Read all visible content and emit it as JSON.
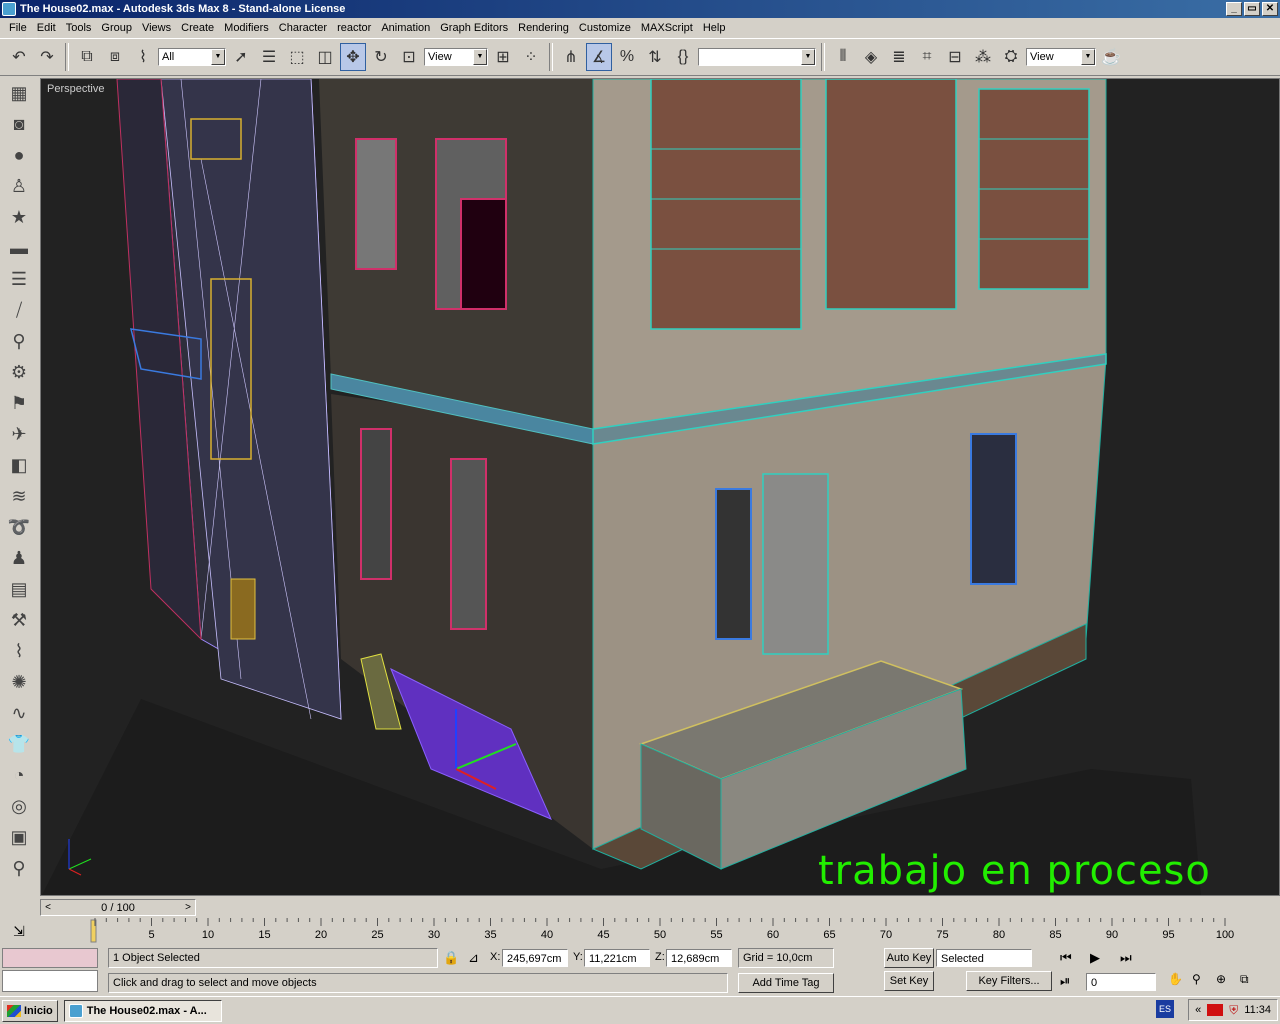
{
  "window": {
    "title": "The House02.max - Autodesk 3ds Max 8  - Stand-alone License",
    "controls": [
      "_",
      "▭",
      "✕"
    ]
  },
  "menu": [
    "File",
    "Edit",
    "Tools",
    "Group",
    "Views",
    "Create",
    "Modifiers",
    "Character",
    "reactor",
    "Animation",
    "Graph Editors",
    "Rendering",
    "Customize",
    "MAXScript",
    "Help"
  ],
  "toolbar": {
    "selection_filter": "All",
    "reference_coord": "View",
    "named_selection": "",
    "view_combo": "View"
  },
  "viewport": {
    "label": "Perspective",
    "overlay_text": "trabajo en proceso"
  },
  "timeline": {
    "frame_display": "0 / 100",
    "ticks": [
      "5",
      "10",
      "15",
      "20",
      "25",
      "30",
      "35",
      "40",
      "45",
      "50",
      "55",
      "60",
      "65",
      "70",
      "75",
      "80",
      "85",
      "90",
      "95",
      "100"
    ]
  },
  "status": {
    "selection": "1 Object Selected",
    "prompt": "Click and drag to select and move objects",
    "x_label": "X:",
    "x_value": "245,697cm",
    "y_label": "Y:",
    "y_value": "11,221cm",
    "z_label": "Z:",
    "z_value": "12,689cm",
    "grid": "Grid = 10,0cm",
    "add_time_tag": "Add Time Tag",
    "auto_key": "Auto Key",
    "selected": "Selected",
    "set_key": "Set Key",
    "key_filters": "Key Filters...",
    "frame_value": "0"
  },
  "taskbar": {
    "start": "Inicio",
    "task": "The House02.max - A...",
    "lang": "ES",
    "clock": "11:34",
    "tray_icons": [
      "ati-icon",
      "shield-icon"
    ]
  }
}
